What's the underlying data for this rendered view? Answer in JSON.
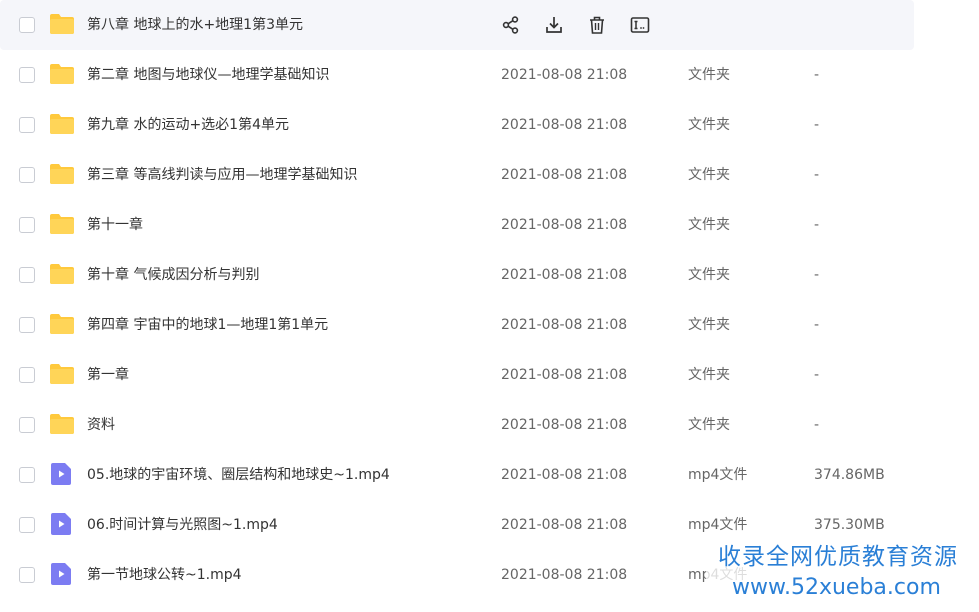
{
  "files": [
    {
      "name": "第八章 地球上的水+地理1第3单元",
      "date": "",
      "type": "",
      "size": "",
      "kind": "folder"
    },
    {
      "name": "第二章 地图与地球仪—地理学基础知识",
      "date": "2021-08-08 21:08",
      "type": "文件夹",
      "size": "-",
      "kind": "folder"
    },
    {
      "name": "第九章 水的运动+选必1第4单元",
      "date": "2021-08-08 21:08",
      "type": "文件夹",
      "size": "-",
      "kind": "folder"
    },
    {
      "name": "第三章 等高线判读与应用—地理学基础知识",
      "date": "2021-08-08 21:08",
      "type": "文件夹",
      "size": "-",
      "kind": "folder"
    },
    {
      "name": "第十一章",
      "date": "2021-08-08 21:08",
      "type": "文件夹",
      "size": "-",
      "kind": "folder"
    },
    {
      "name": "第十章 气候成因分析与判别",
      "date": "2021-08-08 21:08",
      "type": "文件夹",
      "size": "-",
      "kind": "folder"
    },
    {
      "name": "第四章 宇宙中的地球1—地理1第1单元",
      "date": "2021-08-08 21:08",
      "type": "文件夹",
      "size": "-",
      "kind": "folder"
    },
    {
      "name": "第一章",
      "date": "2021-08-08 21:08",
      "type": "文件夹",
      "size": "-",
      "kind": "folder"
    },
    {
      "name": "资料",
      "date": "2021-08-08 21:08",
      "type": "文件夹",
      "size": "-",
      "kind": "folder"
    },
    {
      "name": "05.地球的宇宙环境、圈层结构和地球史~1.mp4",
      "date": "2021-08-08 21:08",
      "type": "mp4文件",
      "size": "374.86MB",
      "kind": "video"
    },
    {
      "name": "06.时间计算与光照图~1.mp4",
      "date": "2021-08-08 21:08",
      "type": "mp4文件",
      "size": "375.30MB",
      "kind": "video"
    },
    {
      "name": "第一节地球公转~1.mp4",
      "date": "2021-08-08 21:08",
      "type": "mp4文件",
      "size": "",
      "kind": "video"
    }
  ],
  "hover_actions": [
    "share-icon",
    "download-icon",
    "delete-icon",
    "rename-icon"
  ],
  "colors": {
    "folder": "#FFC93C",
    "video": "#7C7CF2",
    "watermark": "#2A7FD6",
    "hover_row": "#F5F6FA"
  },
  "watermark": {
    "line1": "收录全网优质教育资源",
    "line2": "www.52xueba.com"
  }
}
